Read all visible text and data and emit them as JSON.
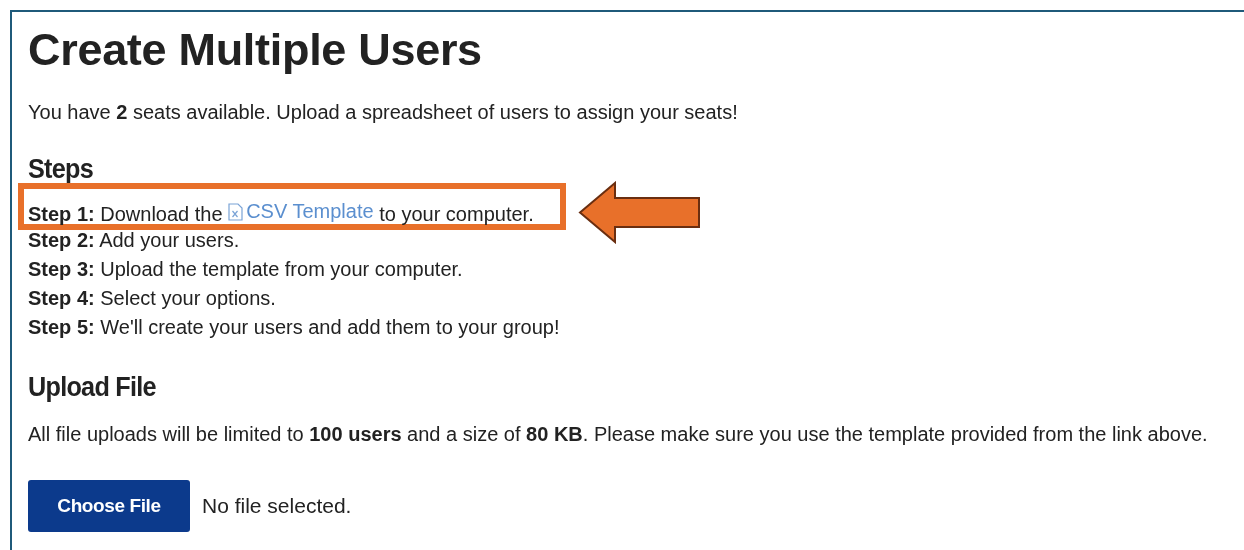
{
  "title": "Create Multiple Users",
  "intro": "You have **2** seats available. Upload a spreadsheet of users to assign your seats!",
  "steps_heading": "Steps",
  "steps": [
    {
      "label": "Step 1:",
      "text": "Download the",
      "link": "CSV Template",
      "after": "to your computer.",
      "highlighted": true
    },
    {
      "label": "Step 2:",
      "text": "Add your users.",
      "highlighted": false
    },
    {
      "label": "Step 3:",
      "text": "Upload the template from your computer.",
      "highlighted": false
    },
    {
      "label": "Step 4:",
      "text": "Select your options.",
      "highlighted": false
    },
    {
      "label": "Step 5:",
      "text": "We'll create your users and add them to your group!",
      "highlighted": false
    }
  ],
  "upload_heading": "Upload File",
  "upload_note": "All file uploads will be limited to **100 users** and a size of **80 KB**. Please make sure you use the template provided from the link above.",
  "file_button": "Choose File",
  "file_status": "No file selected."
}
